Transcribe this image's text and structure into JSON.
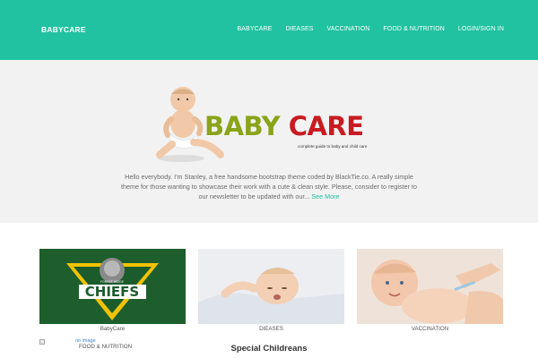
{
  "navbar": {
    "brand": "BABYCARE",
    "items": [
      "BABYCARE",
      "DIEASES",
      "VACCINATION",
      "FOOD & NUTRITION",
      "LOGIN/SIGN IN"
    ]
  },
  "hero": {
    "logo_word1": "BABY",
    "logo_word2": "CARE",
    "tagline": "complete guide to baby and child care",
    "intro_text": "Hello everybody. I'm Stanley, a free handsome bootstrap theme coded by BlackTie.co. A really simple theme for those wanting to showcase their work with a cute & clean style. Please, consider to register to our newsletter to be updated with our...",
    "see_more": "See More"
  },
  "cards": [
    {
      "caption": "BabyCare",
      "image_text": "CHIEFS",
      "image_subtext": "FOREST RIDGE"
    },
    {
      "caption": "DIEASES"
    },
    {
      "caption": "VACCINATION"
    }
  ],
  "broken_image": {
    "alt": "no image",
    "label": "FOOD & NUTRITION"
  },
  "section_title": "Special Childreans",
  "colors": {
    "accent": "#21c2a1",
    "logo_green": "#8aa41a",
    "logo_red": "#c81b22",
    "hero_bg": "#f2f2f2"
  }
}
